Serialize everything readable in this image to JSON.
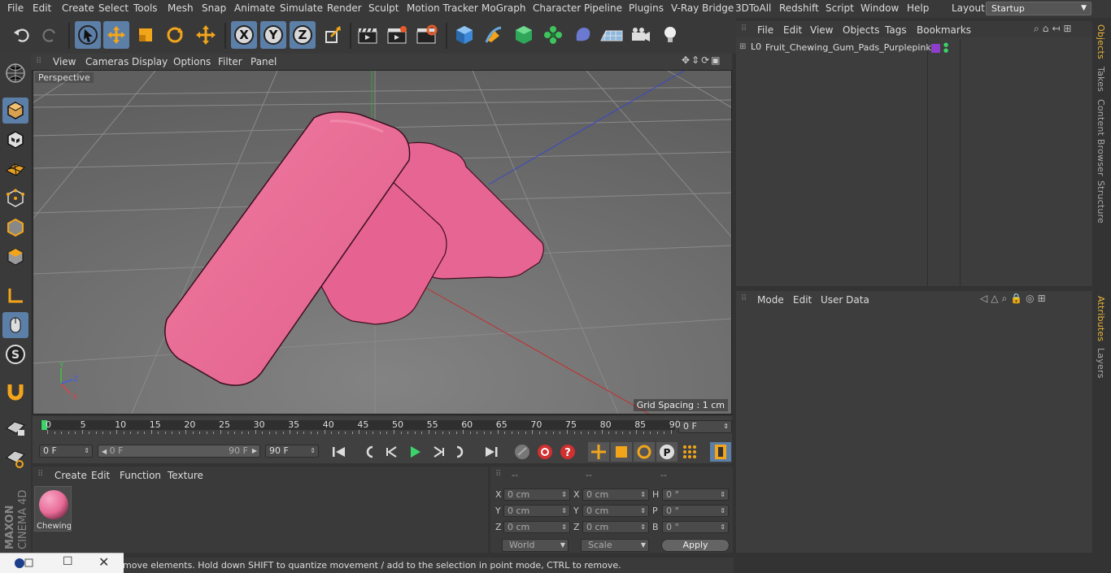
{
  "menubar": {
    "items": [
      "File",
      "Edit",
      "Create",
      "Select",
      "Tools",
      "Mesh",
      "Snap",
      "Animate",
      "Simulate",
      "Render",
      "Sculpt",
      "Motion Tracker",
      "MoGraph",
      "Character",
      "Pipeline",
      "Plugins",
      "V-Ray Bridge",
      "3DToAll",
      "Redshift",
      "Script",
      "Window",
      "Help"
    ],
    "layout_label": "Layout:",
    "layout_value": "Startup"
  },
  "viewport": {
    "menus": [
      "View",
      "Cameras",
      "Display",
      "Options",
      "Filter",
      "Panel"
    ],
    "label": "Perspective",
    "grid_spacing": "Grid Spacing : 1 cm"
  },
  "timeline": {
    "ticks": [
      "0",
      "5",
      "10",
      "15",
      "20",
      "25",
      "30",
      "35",
      "40",
      "45",
      "50",
      "55",
      "60",
      "65",
      "70",
      "75",
      "80",
      "85",
      "90"
    ],
    "current_frame": "0 F",
    "start_field": "0 F",
    "range_start": "0 F",
    "range_end": "90 F",
    "end_field": "90 F"
  },
  "materials": {
    "menus": [
      "Create",
      "Edit",
      "Function",
      "Texture"
    ],
    "items": [
      {
        "label": "Chewing",
        "color": "#e86c98"
      }
    ]
  },
  "coords": {
    "headers": [
      "--",
      "--",
      "--"
    ],
    "rows": [
      {
        "a": "X",
        "av": "0 cm",
        "b": "X",
        "bv": "0 cm",
        "c": "H",
        "cv": "0 °"
      },
      {
        "a": "Y",
        "av": "0 cm",
        "b": "Y",
        "bv": "0 cm",
        "c": "P",
        "cv": "0 °"
      },
      {
        "a": "Z",
        "av": "0 cm",
        "b": "Z",
        "bv": "0 cm",
        "c": "B",
        "cv": "0 °"
      }
    ],
    "world": "World",
    "scale": "Scale",
    "apply": "Apply"
  },
  "objects_panel": {
    "menus": [
      "File",
      "Edit",
      "View",
      "Objects",
      "Tags",
      "Bookmarks"
    ],
    "object_name": "Fruit_Chewing_Gum_Pads_Purplepink",
    "tag_color": "#8e3fc9"
  },
  "attributes_panel": {
    "menus": [
      "Mode",
      "Edit",
      "User Data"
    ]
  },
  "right_tabs": {
    "top": [
      "Objects",
      "Takes",
      "Content Browser",
      "Structure"
    ],
    "bottom": [
      "Attributes",
      "Layers"
    ]
  },
  "status": {
    "text": "move elements. Hold down SHIFT to quantize movement / add to the selection in point mode, CTRL to remove."
  },
  "brand": {
    "top": "MAXON",
    "bottom": "CINEMA 4D"
  },
  "colors": {
    "accent": "#5c7fa8",
    "gum": "#e8678f",
    "active_tab": "#e8b53a"
  }
}
